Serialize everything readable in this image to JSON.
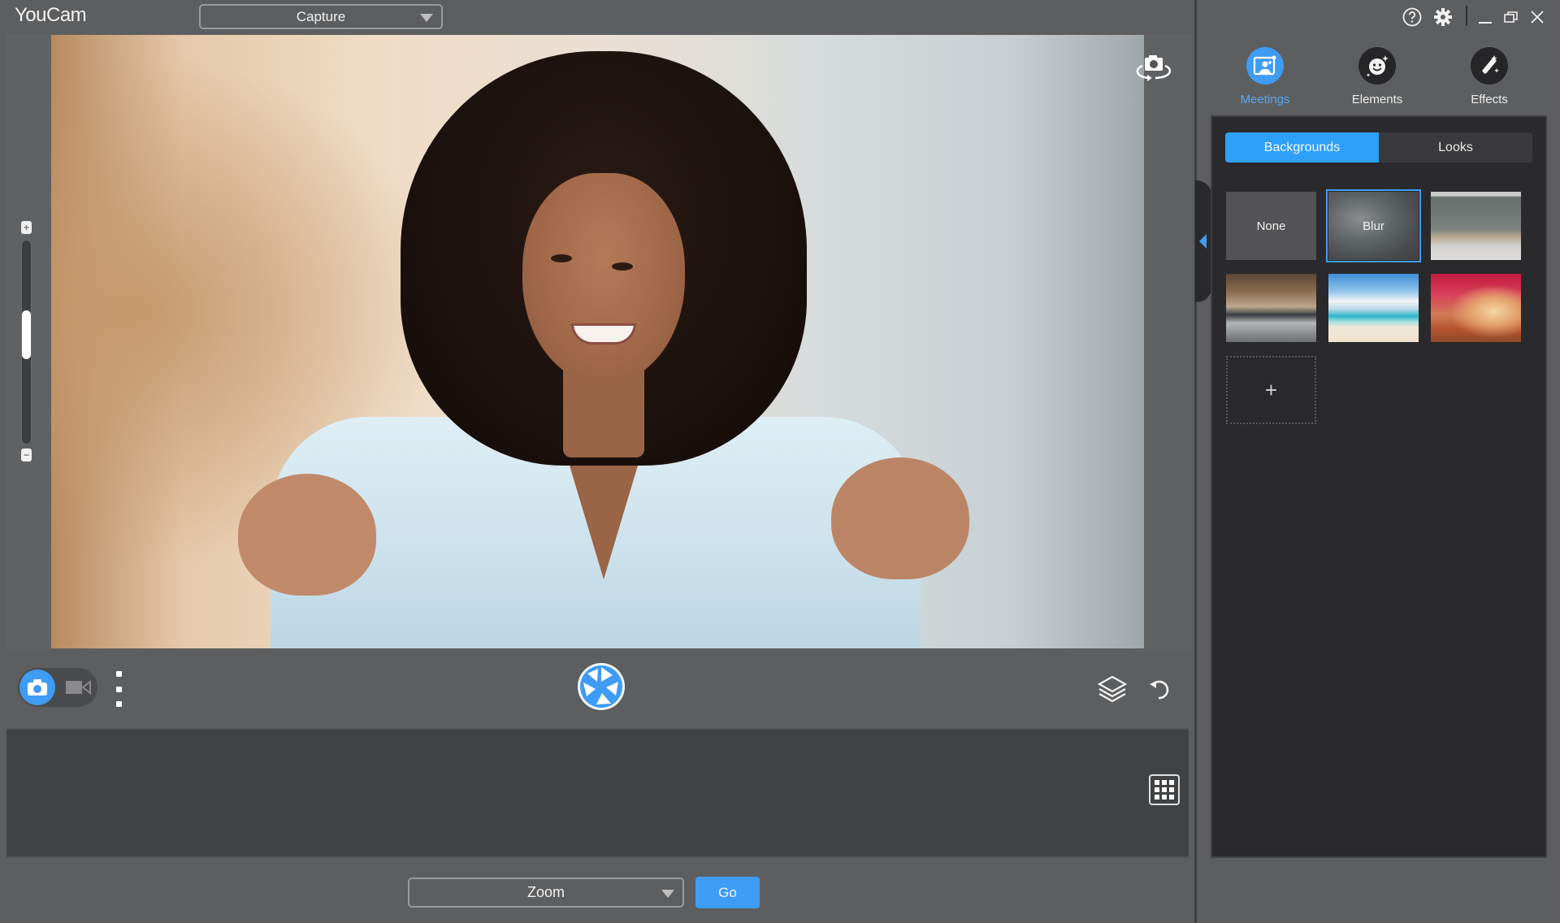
{
  "app": {
    "title": "YouCam",
    "mode_dropdown": {
      "value": "Capture"
    },
    "window_controls": {
      "help": "help-icon",
      "settings": "gear-icon",
      "minimize": "minimize-icon",
      "restore": "restore-icon",
      "close": "close-icon"
    }
  },
  "preview": {
    "switch_camera_icon": "camera-switch-icon",
    "zoom_slider": {
      "value_fraction": 0.55,
      "plus": "+",
      "minus": "−"
    }
  },
  "controls": {
    "capture_mode": "photo",
    "modes": [
      "photo",
      "video"
    ],
    "shutter_icon": "shutter-icon",
    "layers_icon": "layers-icon",
    "undo_icon": "undo-icon",
    "more_icon": "more-vertical-icon"
  },
  "thumbnail_strip": {
    "grid_icon": "grid-view-icon"
  },
  "bottom": {
    "app_dropdown": {
      "value": "Zoom"
    },
    "go_label": "Go"
  },
  "side_panel": {
    "nav": [
      {
        "label": "Meetings",
        "icon": "meetings-icon",
        "active": true
      },
      {
        "label": "Elements",
        "icon": "elements-icon",
        "active": false
      },
      {
        "label": "Effects",
        "icon": "effects-icon",
        "active": false
      }
    ],
    "tabs": [
      {
        "label": "Backgrounds",
        "active": true
      },
      {
        "label": "Looks",
        "active": false
      }
    ],
    "backgrounds": [
      {
        "label": "None",
        "kind": "none"
      },
      {
        "label": "Blur",
        "kind": "blur",
        "selected": true
      },
      {
        "label": "",
        "kind": "living-room"
      },
      {
        "label": "",
        "kind": "office"
      },
      {
        "label": "",
        "kind": "beach"
      },
      {
        "label": "",
        "kind": "autumn-forest"
      }
    ],
    "add_label": "+"
  },
  "colors": {
    "accent": "#3e9cf4",
    "tab_active": "#2ea0f8",
    "panel_dark": "#2a2a2c",
    "chrome": "#5d5e60"
  }
}
